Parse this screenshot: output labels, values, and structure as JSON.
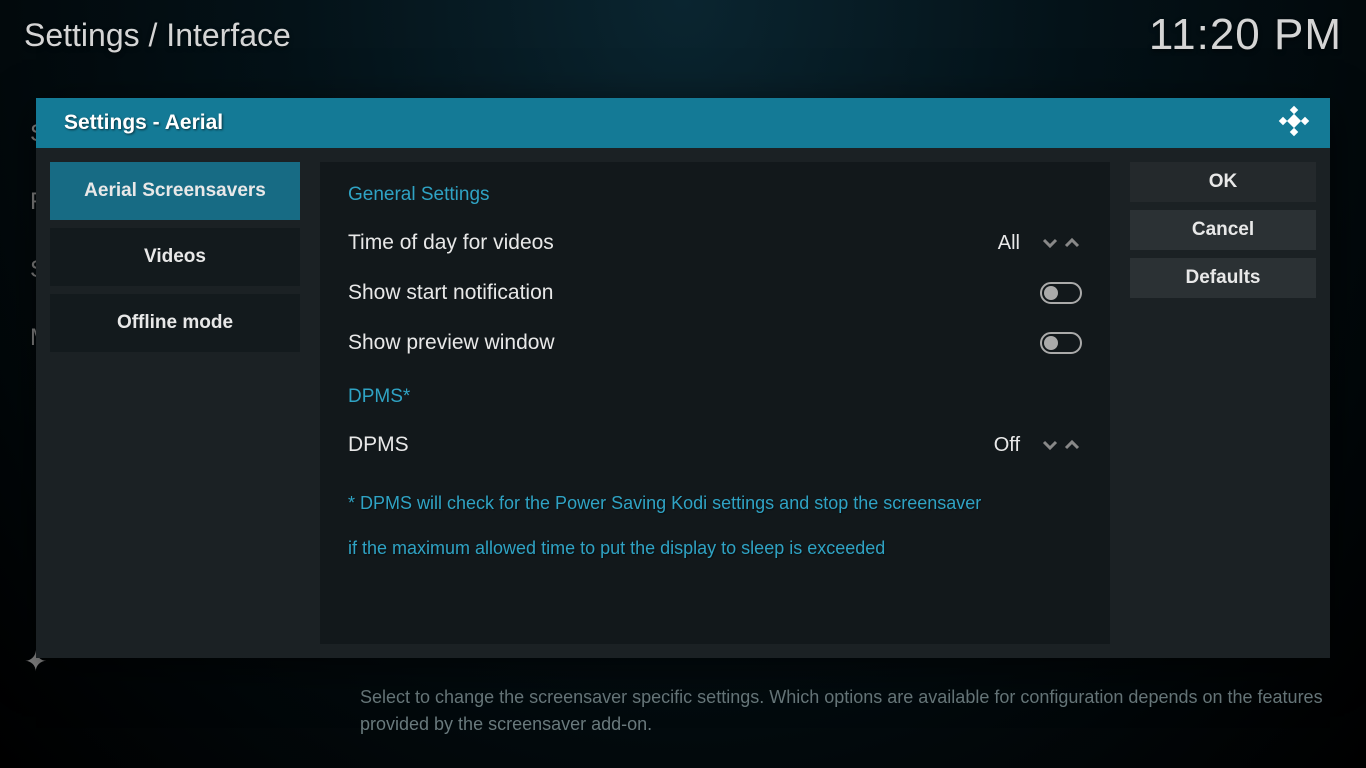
{
  "background": {
    "breadcrumb": "Settings / Interface",
    "clock": "11:20 PM",
    "help_text": "Select to change the screensaver specific settings. Which options are available for configuration depends on the features provided by the screensaver add-on.",
    "sidebar_char1": "S",
    "sidebar_char2": "F",
    "sidebar_char3": "S",
    "sidebar_char4": "M"
  },
  "dialog": {
    "title": "Settings - Aerial",
    "categories": [
      "Aerial Screensavers",
      "Videos",
      "Offline mode"
    ],
    "sections": {
      "general": {
        "header": "General Settings",
        "time_of_day_label": "Time of day for videos",
        "time_of_day_value": "All",
        "show_start_label": "Show start notification",
        "show_preview_label": "Show preview window"
      },
      "dpms": {
        "header": "DPMS*",
        "dpms_label": "DPMS",
        "dpms_value": "Off",
        "note_line1": "* DPMS will check for the Power Saving Kodi settings and stop the screensaver",
        "note_line2": "if the maximum allowed time to put the display to sleep is exceeded"
      }
    },
    "buttons": {
      "ok": "OK",
      "cancel": "Cancel",
      "defaults": "Defaults"
    }
  }
}
